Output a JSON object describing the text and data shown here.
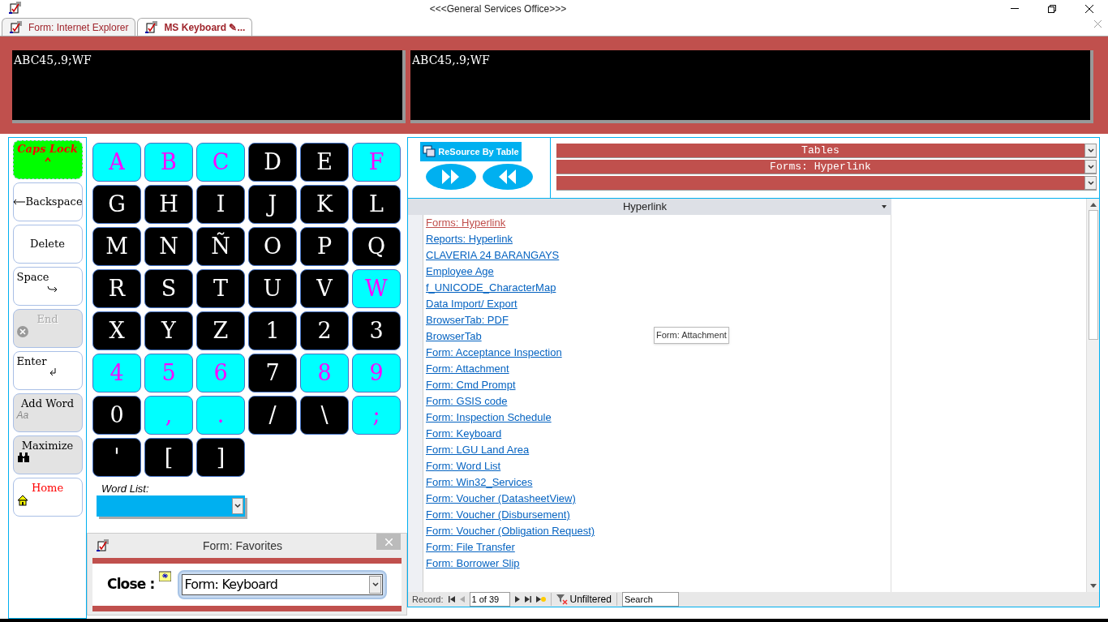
{
  "window": {
    "title": "<<<General Services Office>>>"
  },
  "tabs": [
    {
      "label": "Form: Internet Explorer",
      "selected": false
    },
    {
      "label": "MS Keyboard ✎...",
      "selected": true
    }
  ],
  "displays": [
    "ABC45,.9;WF",
    "ABC45,.9;WF"
  ],
  "side_buttons": [
    {
      "label": "Caps Lock",
      "kind": "caps",
      "on": true
    },
    {
      "label": "Backspace",
      "kind": "backspace"
    },
    {
      "label": "Delete",
      "kind": "plain"
    },
    {
      "label": "Space",
      "kind": "space"
    },
    {
      "label": "End",
      "kind": "end",
      "disabled": true
    },
    {
      "label": "Enter",
      "kind": "enter"
    },
    {
      "label": "Add Word",
      "kind": "addword",
      "icon_text": "Aa"
    },
    {
      "label": "Maximize",
      "kind": "maximize"
    },
    {
      "label": "Home",
      "kind": "home"
    }
  ],
  "keys": [
    {
      "label": "A",
      "kind": "cyan"
    },
    {
      "label": "B",
      "kind": "cyan"
    },
    {
      "label": "C",
      "kind": "cyan"
    },
    {
      "label": "D",
      "kind": "dark"
    },
    {
      "label": "E",
      "kind": "dark"
    },
    {
      "label": "F",
      "kind": "cyan"
    },
    {
      "label": "G",
      "kind": "dark"
    },
    {
      "label": "H",
      "kind": "dark"
    },
    {
      "label": "I",
      "kind": "dark"
    },
    {
      "label": "J",
      "kind": "dark"
    },
    {
      "label": "K",
      "kind": "dark"
    },
    {
      "label": "L",
      "kind": "dark"
    },
    {
      "label": "M",
      "kind": "dark"
    },
    {
      "label": "N",
      "kind": "dark"
    },
    {
      "label": "Ñ",
      "kind": "dark"
    },
    {
      "label": "O",
      "kind": "dark"
    },
    {
      "label": "P",
      "kind": "dark"
    },
    {
      "label": "Q",
      "kind": "dark"
    },
    {
      "label": "R",
      "kind": "dark"
    },
    {
      "label": "S",
      "kind": "dark"
    },
    {
      "label": "T",
      "kind": "dark"
    },
    {
      "label": "U",
      "kind": "dark"
    },
    {
      "label": "V",
      "kind": "dark"
    },
    {
      "label": "W",
      "kind": "cyan"
    },
    {
      "label": "X",
      "kind": "dark"
    },
    {
      "label": "Y",
      "kind": "dark"
    },
    {
      "label": "Z",
      "kind": "dark"
    },
    {
      "label": "1",
      "kind": "dark"
    },
    {
      "label": "2",
      "kind": "dark"
    },
    {
      "label": "3",
      "kind": "dark"
    },
    {
      "label": "4",
      "kind": "cyan"
    },
    {
      "label": "5",
      "kind": "cyan"
    },
    {
      "label": "6",
      "kind": "cyan"
    },
    {
      "label": "7",
      "kind": "dark"
    },
    {
      "label": "8",
      "kind": "cyan"
    },
    {
      "label": "9",
      "kind": "cyan"
    },
    {
      "label": "0",
      "kind": "dark"
    },
    {
      "label": ",",
      "kind": "cyan"
    },
    {
      "label": ".",
      "kind": "cyan"
    },
    {
      "label": "/",
      "kind": "dark"
    },
    {
      "label": "\\",
      "kind": "dark"
    },
    {
      "label": ";",
      "kind": "cyan"
    },
    {
      "label": "'",
      "kind": "dark"
    },
    {
      "label": "[",
      "kind": "dark"
    },
    {
      "label": "]",
      "kind": "dark"
    }
  ],
  "word_list": {
    "label": "Word List:"
  },
  "favorites": {
    "title": "Form: Favorites",
    "close_label": "Close :",
    "value": "Form: Keyboard"
  },
  "resource_button": {
    "label": "ReSource By Table"
  },
  "dropdowns": [
    {
      "kind": "combo",
      "value": "Tables"
    },
    {
      "kind": "combo",
      "value": "Forms: Hyperlink"
    },
    {
      "kind": "combo"
    }
  ],
  "table": {
    "column": "Hyperlink",
    "rows": [
      {
        "text": "Forms: Hyperlink",
        "visited": true
      },
      {
        "text": "Reports: Hyperlink",
        "visited": false
      },
      {
        "text": "CLAVERIA 24 BARANGAYS",
        "visited": false
      },
      {
        "text": "Employee Age",
        "visited": false
      },
      {
        "text": "f_UNICODE_CharacterMap",
        "visited": false
      },
      {
        "text": "Data Import/ Export",
        "visited": false
      },
      {
        "text": "BrowserTab: PDF",
        "visited": false
      },
      {
        "text": "BrowserTab",
        "visited": false
      },
      {
        "text": "Form: Acceptance Inspection",
        "visited": false
      },
      {
        "text": "Form: Attachment",
        "visited": false
      },
      {
        "text": "Form: Cmd Prompt",
        "visited": false
      },
      {
        "text": "Form: GSIS code",
        "visited": false
      },
      {
        "text": "Form: Inspection Schedule",
        "visited": false
      },
      {
        "text": "Form: Keyboard",
        "visited": false
      },
      {
        "text": "Form: LGU Land Area",
        "visited": false
      },
      {
        "text": "Form: Word List",
        "visited": false
      },
      {
        "text": "Form: Win32_Services",
        "visited": false
      },
      {
        "text": "Form: Voucher (DatasheetView)",
        "visited": false
      },
      {
        "text": "Form: Voucher (Disbursement)",
        "visited": false
      },
      {
        "text": "Form: Voucher (Obligation Request)",
        "visited": false
      },
      {
        "text": "Form: File Transfer",
        "visited": false
      },
      {
        "text": "Form: Borrower Slip",
        "visited": false
      }
    ]
  },
  "tooltip": "Form: Attachment",
  "navigator": {
    "label": "Record:",
    "position": "1 of 39",
    "filter": "Unfiltered",
    "search": "Search"
  }
}
